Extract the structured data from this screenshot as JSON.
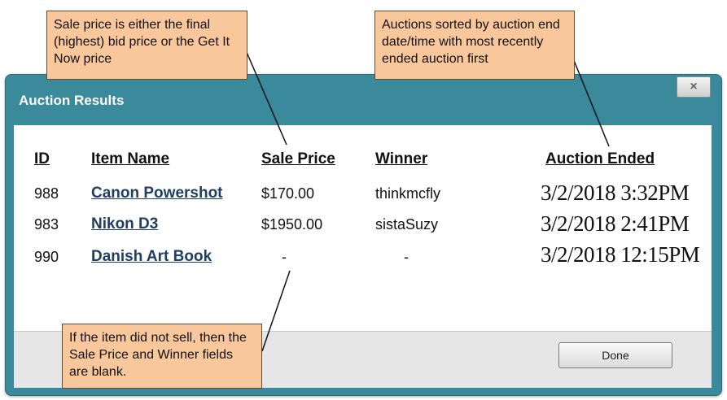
{
  "window": {
    "title": "Auction Results",
    "close_label": "×",
    "done_label": "Done"
  },
  "table": {
    "headers": [
      "ID",
      "Item Name",
      "Sale Price",
      "Winner",
      "Auction Ended"
    ],
    "rows": [
      {
        "id": "988",
        "item": "Canon Powershot",
        "price": "$170.00",
        "winner": "thinkmcfly",
        "ended": "3/2/2018 3:32PM"
      },
      {
        "id": "983",
        "item": "Nikon D3",
        "price": "$1950.00",
        "winner": "sistaSuzy",
        "ended": "3/2/2018 2:41PM"
      },
      {
        "id": "990",
        "item": "Danish Art Book",
        "price": "-",
        "winner": "-",
        "ended": "3/2/2018 12:15PM"
      }
    ]
  },
  "callouts": {
    "sale_price": "Sale price is either the final (highest) bid price or the Get It Now price",
    "sorting": "Auctions sorted by auction end date/time with most recently ended auction first",
    "blank": "If the item did not sell, then the Sale Price and Winner fields are blank."
  },
  "colors": {
    "titlebar": "#3a8a9c",
    "callout": "#f9c79c",
    "link": "#1f3e63"
  }
}
